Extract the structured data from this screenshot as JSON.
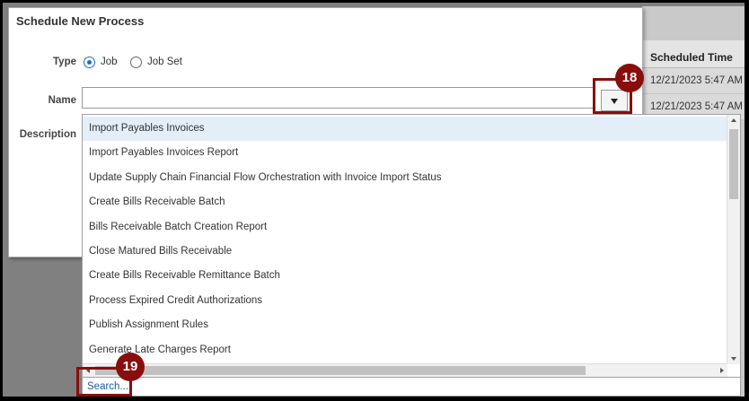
{
  "dialog": {
    "title": "Schedule New Process",
    "type_label": "Type",
    "type_options": [
      "Job",
      "Job Set"
    ],
    "type_selected": "Job",
    "name_label": "Name",
    "name_value": "",
    "description_label": "Description"
  },
  "background_table": {
    "header": "Scheduled Time",
    "rows": [
      "12/21/2023 5:47 AM",
      "12/21/2023 5:47 AM"
    ]
  },
  "dropdown": {
    "items": [
      "Import Payables Invoices",
      "Import Payables Invoices Report",
      "Update Supply Chain Financial Flow Orchestration with Invoice Import Status",
      "Create Bills Receivable Batch",
      "Bills Receivable Batch Creation Report",
      "Close Matured Bills Receivable",
      "Create Bills Receivable Remittance Batch",
      "Process Expired Credit Authorizations",
      "Publish Assignment Rules",
      "Generate Late Charges Report"
    ],
    "highlighted_index": 0,
    "search_link": "Search..."
  },
  "callouts": [
    "18",
    "19"
  ],
  "colors": {
    "callout": "#8a0d0d",
    "highlight": "#e3eef9",
    "link": "#1a5fa3",
    "overlay": "#808080"
  }
}
